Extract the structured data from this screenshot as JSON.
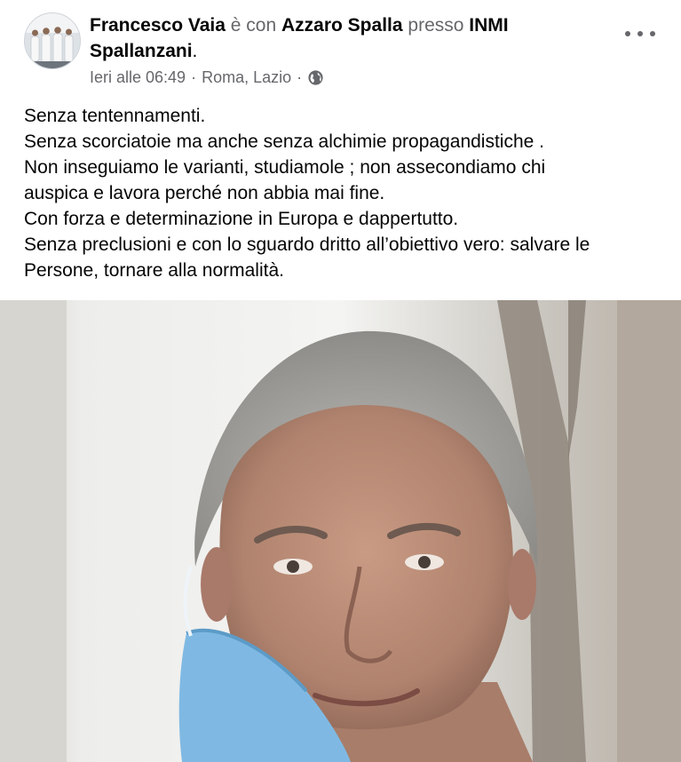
{
  "post": {
    "author": "Francesco Vaia",
    "with_word": "è con",
    "tagged": "Azzaro Spalla",
    "at_word": "presso",
    "place_line1": "INMI",
    "place_line2": "Spallanzani",
    "place_suffix": ".",
    "time": "Ieri alle 06:49",
    "sep1": "·",
    "location": "Roma, Lazio",
    "sep2": "·",
    "privacy_icon": "globe-icon",
    "more_icon": "more-options-icon"
  },
  "text_lines": [
    "Senza tentennamenti.",
    "Senza scorciatoie ma anche senza alchimie propagandistiche .",
    "Non inseguiamo le varianti, studiamole ; non assecondiamo chi",
    "auspica e lavora perché non abbia mai fine.",
    "Con forza e determinazione in Europa e dappertutto.",
    "Senza preclusioni e con lo sguardo dritto all’obiettivo vero: salvare le",
    "Persone, tornare alla normalità."
  ],
  "colors": {
    "text": "#050505",
    "secondary": "#65676b",
    "mask": "#7fb9e3"
  }
}
